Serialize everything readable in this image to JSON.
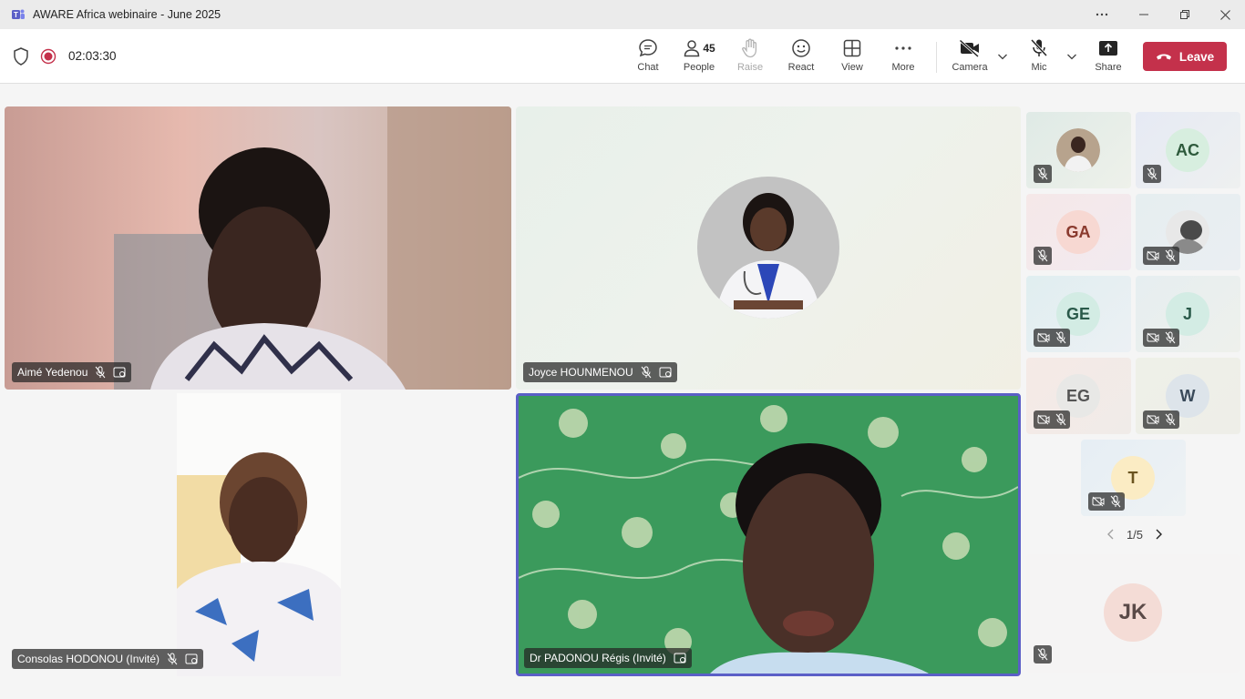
{
  "window": {
    "title": "AWARE Africa webinaire - June 2025",
    "app_icon": "teams-icon",
    "controls": [
      "more-icon",
      "minimize-icon",
      "maximize-icon",
      "close-icon"
    ]
  },
  "toolbar": {
    "timer": "02:03:30",
    "buttons": {
      "chat": "Chat",
      "people": "People",
      "people_count": "45",
      "raise": "Raise",
      "react": "React",
      "view": "View",
      "more": "More",
      "camera": "Camera",
      "mic": "Mic",
      "share": "Share"
    },
    "leave_label": "Leave",
    "leave_color": "#c4314b"
  },
  "participants": {
    "tile1_name": "Aimé Yedenou",
    "tile2_name": "Joyce HOUNMENOU",
    "tile3_name": "Consolas HODONOU (Invité)",
    "tile4_name": "Dr PADONOU Régis (Invité)"
  },
  "gallery": {
    "ac": "AC",
    "ga": "GA",
    "ge": "GE",
    "j": "J",
    "eg": "EG",
    "w": "W",
    "t": "T",
    "page": "1/5",
    "jk": "JK"
  },
  "colors": {
    "active_speaker_border": "#5b5fc7",
    "accent": "#5b5fc7"
  }
}
